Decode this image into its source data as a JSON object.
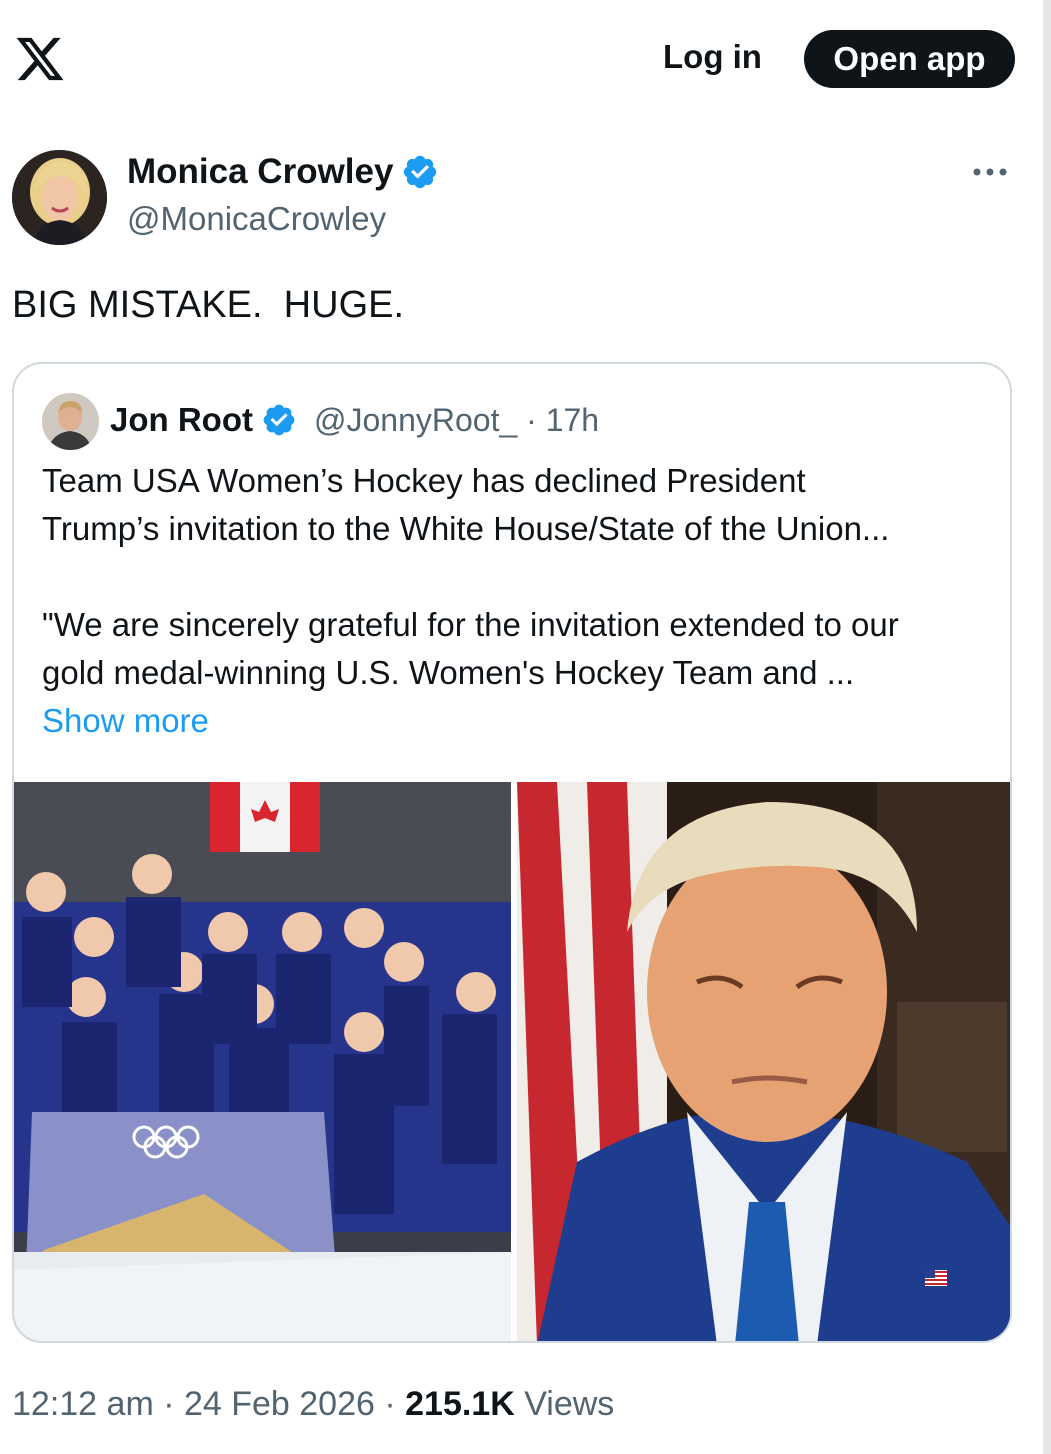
{
  "topbar": {
    "login_label": "Log in",
    "open_app_label": "Open app"
  },
  "tweet": {
    "author_name": "Monica Crowley",
    "author_handle": "@MonicaCrowley",
    "text": "BIG MISTAKE.  HUGE.",
    "timestamp": "12:12 am · 24 Feb 2026 · ",
    "views_count": "215.1K",
    "views_label": " Views"
  },
  "quote": {
    "author_name": "Jon Root",
    "author_handle": "@JonnyRoot_",
    "time": "· 17h",
    "lines": [
      "Team USA Women’s Hockey has declined President",
      "Trump’s invitation to the White House/State of the Union...",
      "\"We are sincerely grateful for the invitation extended to our",
      "gold medal-winning U.S. Women's Hockey Team and ..."
    ],
    "show_more": "Show more",
    "images": [
      "team-usa-hockey-photo",
      "trump-portrait-photo"
    ]
  },
  "colors": {
    "verified_blue": "#1d9bf0",
    "text_primary": "#0f1419",
    "text_secondary": "#536471",
    "border": "#cfd9de"
  }
}
